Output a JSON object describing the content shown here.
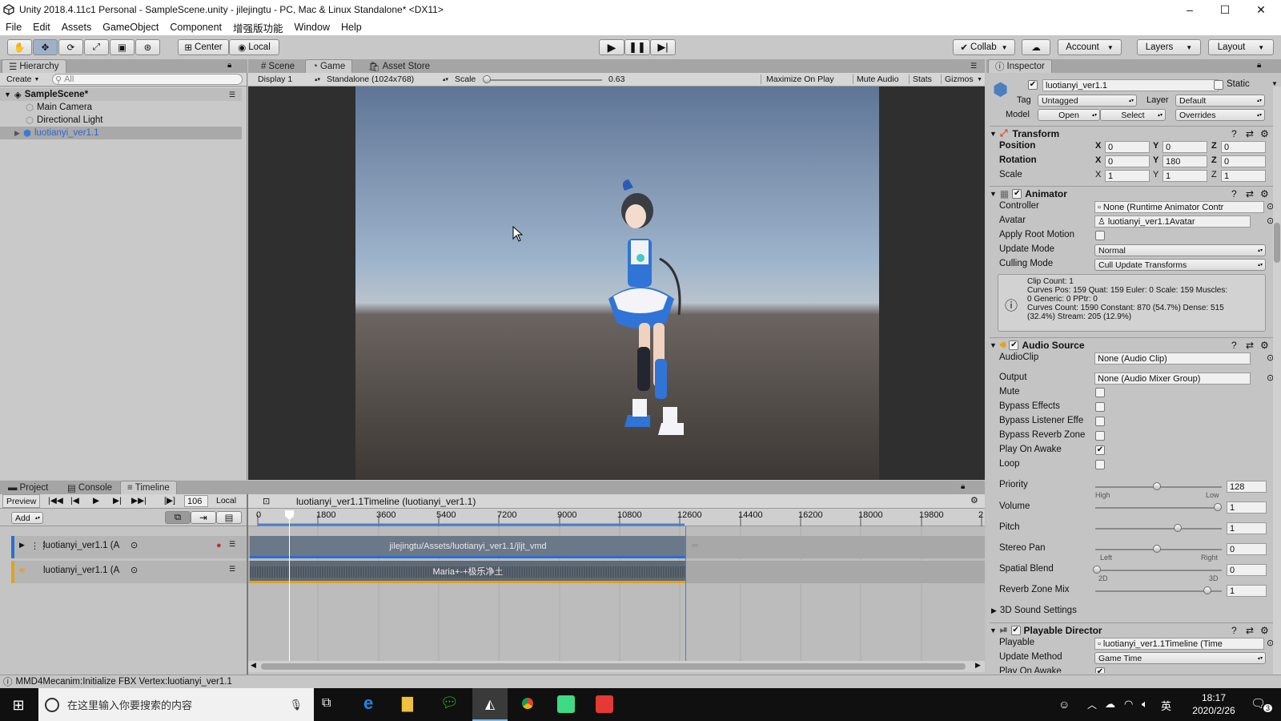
{
  "window": {
    "title": "Unity 2018.4.11c1 Personal - SampleScene.unity - jilejingtu - PC, Mac & Linux Standalone* <DX11>",
    "minimize": "–",
    "maximize": "☐",
    "close": "✕"
  },
  "menu": [
    "File",
    "Edit",
    "Assets",
    "GameObject",
    "Component",
    "增强版功能",
    "Window",
    "Help"
  ],
  "toolbar": {
    "pivot": "Center",
    "space": "Local",
    "collab": "Collab",
    "account": "Account",
    "layers": "Layers",
    "layout": "Layout"
  },
  "hierarchy": {
    "tab": "Hierarchy",
    "create": "Create",
    "search_placeholder": "All",
    "scene": "SampleScene*",
    "items": [
      "Main Camera",
      "Directional Light",
      "luotianyi_ver1.1"
    ]
  },
  "game_view": {
    "tabs": [
      "Scene",
      "Game",
      "Asset Store"
    ],
    "display": "Display 1",
    "resolution": "Standalone (1024x768)",
    "scale_label": "Scale",
    "scale_value": "0.63",
    "buttons": [
      "Maximize On Play",
      "Mute Audio",
      "Stats",
      "Gizmos"
    ]
  },
  "bottom": {
    "tabs": [
      "Project",
      "Console",
      "Timeline"
    ],
    "preview": "Preview",
    "frame": "106",
    "local": "Local",
    "add": "Add",
    "timeline_asset": "luotianyi_ver1.1Timeline (luotianyi_ver1.1)",
    "ruler": [
      "0",
      "1800",
      "3600",
      "5400",
      "7200",
      "9000",
      "10800",
      "12600",
      "14400",
      "16200",
      "18000",
      "19800",
      "2"
    ],
    "tracks": [
      {
        "label": "luotianyi_ver1.1 (A",
        "clip": "jilejingtu/Assets/luotianyi_ver1.1/jljt_vmd"
      },
      {
        "label": "luotianyi_ver1.1 (A",
        "clip": "Maria+-+极乐净土"
      }
    ]
  },
  "inspector": {
    "tab": "Inspector",
    "object_name": "luotianyi_ver1.1",
    "static": "Static",
    "tag_label": "Tag",
    "tag": "Untagged",
    "layer_label": "Layer",
    "layer": "Default",
    "model_label": "Model",
    "open": "Open",
    "select": "Select",
    "overrides": "Overrides",
    "transform": {
      "title": "Transform",
      "position": {
        "label": "Position",
        "x": "0",
        "y": "0",
        "z": "0"
      },
      "rotation": {
        "label": "Rotation",
        "x": "0",
        "y": "180",
        "z": "0"
      },
      "scale": {
        "label": "Scale",
        "x": "1",
        "y": "1",
        "z": "1"
      }
    },
    "animator": {
      "title": "Animator",
      "controller_label": "Controller",
      "controller": "None (Runtime Animator Contr",
      "avatar_label": "Avatar",
      "avatar": "luotianyi_ver1.1Avatar",
      "apply_root_motion": "Apply Root Motion",
      "update_mode_label": "Update Mode",
      "update_mode": "Normal",
      "culling_mode_label": "Culling Mode",
      "culling_mode": "Cull Update Transforms",
      "info": [
        "Clip Count: 1",
        "Curves Pos: 159 Quat: 159 Euler: 0 Scale: 159 Muscles:",
        "0 Generic: 0 PPtr: 0",
        "Curves Count: 1590 Constant: 870 (54.7%) Dense: 515",
        "(32.4%) Stream: 205 (12.9%)"
      ]
    },
    "audio_source": {
      "title": "Audio Source",
      "audioclip_label": "AudioClip",
      "audioclip": "None (Audio Clip)",
      "output_label": "Output",
      "output": "None (Audio Mixer Group)",
      "checks": [
        {
          "label": "Mute",
          "checked": false
        },
        {
          "label": "Bypass Effects",
          "checked": false
        },
        {
          "label": "Bypass Listener Effe",
          "checked": false
        },
        {
          "label": "Bypass Reverb Zone",
          "checked": false
        },
        {
          "label": "Play On Awake",
          "checked": true
        },
        {
          "label": "Loop",
          "checked": false
        }
      ],
      "priority": {
        "label": "Priority",
        "value": "128",
        "high": "High",
        "low": "Low"
      },
      "volume": {
        "label": "Volume",
        "value": "1"
      },
      "pitch": {
        "label": "Pitch",
        "value": "1"
      },
      "stereo_pan": {
        "label": "Stereo Pan",
        "value": "0",
        "left": "Left",
        "right": "Right"
      },
      "spatial_blend": {
        "label": "Spatial Blend",
        "value": "0",
        "min": "2D",
        "max": "3D"
      },
      "reverb_zone_mix": {
        "label": "Reverb Zone Mix",
        "value": "1"
      },
      "sound_settings": "3D Sound Settings"
    },
    "playable_director": {
      "title": "Playable Director",
      "playable_label": "Playable",
      "playable": "luotianyi_ver1.1Timeline (Time",
      "update_method_label": "Update Method",
      "update_method": "Game Time",
      "play_on_awake": "Play On Awake"
    }
  },
  "status_bar": "MMD4Mecanim:Initialize FBX Vertex:luotianyi_ver1.1",
  "taskbar": {
    "search_placeholder": "在这里输入你要搜索的内容",
    "ime": "英",
    "time": "18:17",
    "date": "2020/2/26",
    "notifications": "3"
  },
  "colors": {
    "timeline_anim_accent": "#2b6fcf",
    "timeline_audio_accent": "#e3a21a",
    "taskbar": "#101010",
    "selected_row": "#8cace0"
  }
}
